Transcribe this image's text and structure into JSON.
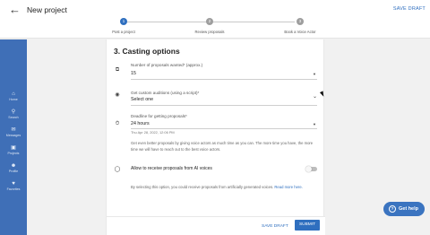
{
  "header": {
    "title": "New project",
    "save_draft": "SAVE DRAFT"
  },
  "stepper": {
    "steps": [
      {
        "number": "1",
        "label": "Post a project",
        "active": true
      },
      {
        "number": "2",
        "label": "Review proposals",
        "active": false
      },
      {
        "number": "3",
        "label": "Book a Voice Actor",
        "active": false
      }
    ],
    "colors": {
      "active": "#2f6fbf",
      "inactive": "#9e9e9e"
    }
  },
  "sidebar": {
    "items": [
      {
        "label": "Home",
        "icon": "home-icon"
      },
      {
        "label": "Search",
        "icon": "search-icon"
      },
      {
        "label": "Messages",
        "icon": "mail-icon"
      },
      {
        "label": "Projects",
        "icon": "briefcase-icon"
      },
      {
        "label": "Profile",
        "icon": "person-icon"
      },
      {
        "label": "Favorites",
        "icon": "heart-icon"
      }
    ]
  },
  "form": {
    "section_title": "3. Casting options",
    "proposals": {
      "label": "Number of proposals wanted* (approx.)",
      "value": "15"
    },
    "auditions": {
      "label": "Get custom auditions (using a script)*",
      "value": "Select one"
    },
    "deadline": {
      "label": "Deadline for getting proposals*",
      "value": "24 hours",
      "helper": "Thu Apr 28, 2022, 12:06 PM"
    },
    "deadline_info": "Get even better proposals by giving voice actors as much time as you can. The more time you have, the more time we will have to reach out to the best voice actors.",
    "ai_toggle": {
      "label": "Allow to receive proposals from AI voices",
      "enabled": false
    },
    "ai_info": "By selecting this option, you could receive proposals from artificially generated voices.",
    "ai_info_link": "Read more here."
  },
  "footer": {
    "save_draft": "SAVE DRAFT",
    "submit": "SUBMIT"
  },
  "help": {
    "label": "Get help"
  },
  "colors": {
    "brand": "#2f6fbf",
    "sidebar": "#3f6fb7",
    "background": "#f1f1f1"
  }
}
